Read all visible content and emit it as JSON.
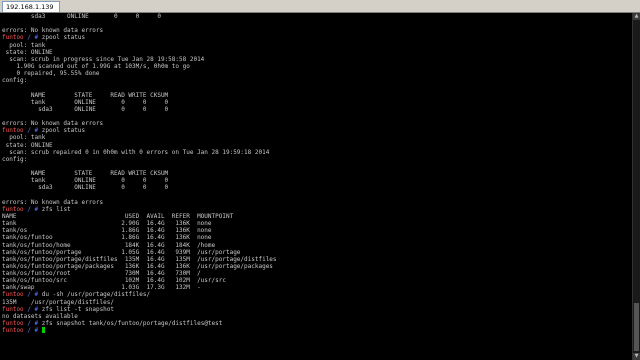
{
  "window": {
    "tab_title": "192.168.1.139"
  },
  "terminal": {
    "prompt_host": "funtoo",
    "prompt_path": "/ # ",
    "lines": [
      {
        "text": "        sda3      ONLINE       0     0     0"
      },
      {
        "text": ""
      },
      {
        "text": "errors: No known data errors"
      },
      {
        "cmd": "zpool status"
      },
      {
        "text": "  pool: tank"
      },
      {
        "text": " state: ONLINE"
      },
      {
        "text": "  scan: scrub in progress since Tue Jan 28 19:58:58 2014"
      },
      {
        "text": "    1.90G scanned out of 1.99G at 103M/s, 0h0m to go"
      },
      {
        "text": "    0 repaired, 95.55% done"
      },
      {
        "text": "config:"
      },
      {
        "text": ""
      },
      {
        "text": "        NAME        STATE     READ WRITE CKSUM"
      },
      {
        "text": "        tank        ONLINE       0     0     0"
      },
      {
        "text": "          sda3      ONLINE       0     0     0"
      },
      {
        "text": ""
      },
      {
        "text": "errors: No known data errors"
      },
      {
        "cmd": "zpool status"
      },
      {
        "text": "  pool: tank"
      },
      {
        "text": " state: ONLINE"
      },
      {
        "text": "  scan: scrub repaired 0 in 0h0m with 0 errors on Tue Jan 28 19:59:18 2014"
      },
      {
        "text": "config:"
      },
      {
        "text": ""
      },
      {
        "text": "        NAME        STATE     READ WRITE CKSUM"
      },
      {
        "text": "        tank        ONLINE       0     0     0"
      },
      {
        "text": "          sda3      ONLINE       0     0     0"
      },
      {
        "text": ""
      },
      {
        "text": "errors: No known data errors"
      },
      {
        "cmd": "zfs list"
      },
      {
        "text": "NAME                              USED  AVAIL  REFER  MOUNTPOINT"
      },
      {
        "text": "tank                             2.90G  16.4G   136K  none"
      },
      {
        "text": "tank/os                          1.86G  16.4G   136K  none"
      },
      {
        "text": "tank/os/funtoo                   1.86G  16.4G   136K  none"
      },
      {
        "text": "tank/os/funtoo/home               184K  16.4G   184K  /home"
      },
      {
        "text": "tank/os/funtoo/portage           1.05G  16.4G   939M  /usr/portage"
      },
      {
        "text": "tank/os/funtoo/portage/distfiles  135M  16.4G   135M  /usr/portage/distfiles"
      },
      {
        "text": "tank/os/funtoo/portage/packages   136K  16.4G   136K  /usr/portage/packages"
      },
      {
        "text": "tank/os/funtoo/root               730M  16.4G   730M  /"
      },
      {
        "text": "tank/os/funtoo/src                102M  16.4G   102M  /usr/src"
      },
      {
        "text": "tank/swap                        1.03G  17.3G   132M  -"
      },
      {
        "cmd": "du -sh /usr/portage/distfiles/"
      },
      {
        "text": "135M    /usr/portage/distfiles/"
      },
      {
        "cmd": "zfs list -t snapshot"
      },
      {
        "text": "no datasets available"
      },
      {
        "cmd": "zfs snapshot tank/os/funtoo/portage/distfiles@test"
      },
      {
        "cmd": "",
        "cursor": true
      }
    ]
  }
}
